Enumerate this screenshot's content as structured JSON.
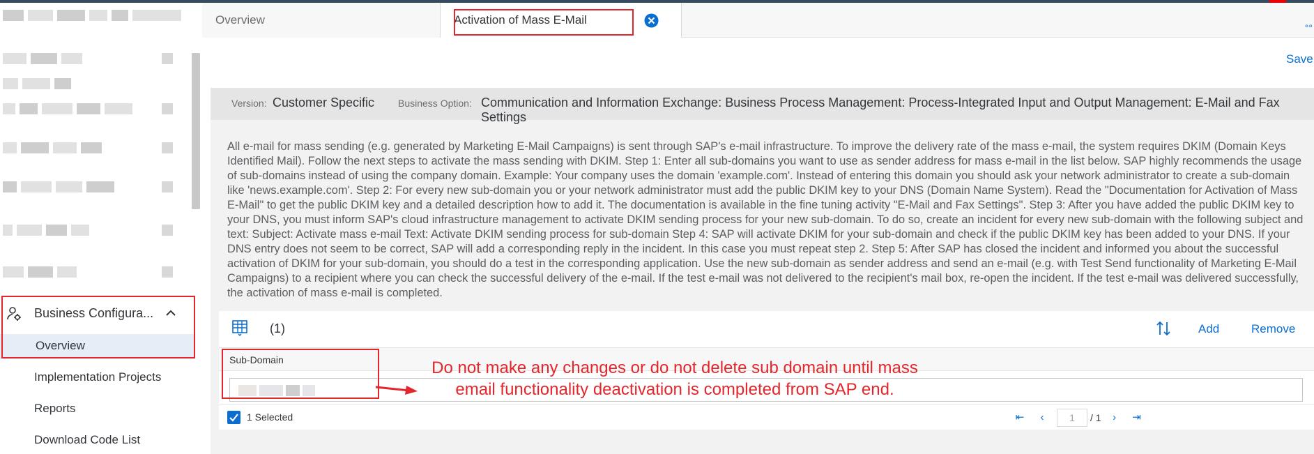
{
  "tabs": {
    "overview": "Overview",
    "active": "Activation of Mass E-Mail"
  },
  "toolbar": {
    "save": "Save",
    "more": "°°"
  },
  "header": {
    "version_label": "Version:",
    "version_value": "Customer Specific",
    "option_label": "Business Option:",
    "option_value": "Communication and Information Exchange: Business Process Management: Process-Integrated Input and Output Management: E-Mail and Fax Settings"
  },
  "description": "All e-mail for mass sending (e.g. generated by Marketing E-Mail Campaigns) is sent through SAP's e-mail infrastructure. To improve the delivery rate of the mass e-mail, the system requires DKIM (Domain Keys Identified Mail). Follow the next steps to activate the mass sending with DKIM. Step 1: Enter all sub-domains you want to use as sender address for mass e-mail in the list below. SAP highly recommends the usage of sub-domains instead of using the company domain. Example: Your company uses the domain 'example.com'. Instead of entering this domain you should ask your network administrator to create a sub-domain like 'news.example.com'. Step 2: For every new sub-domain you or your network administrator must add the public DKIM key to your DNS (Domain Name System). Read the \"Documentation for Activation of Mass E-Mail\" to get the public DKIM key and a detailed description how to add it. The documentation is available in the fine tuning activity \"E-Mail and Fax Settings\". Step 3: After you have added the public DKIM key to your DNS, you must inform SAP's cloud infrastructure management to activate DKIM sending process for your new sub-domain. To do so, create an incident for every new sub-domain with the following subject and text: Subject: Activate mass e-mail Text: Activate DKIM sending process for sub-domain Step 4: SAP will activate DKIM for your sub-domain and check if the public DKIM key has been added to your DNS. If your DNS entry does not seem to be correct, SAP will add a corresponding reply in the incident. In this case you must repeat step 2. Step 5: After SAP has closed the incident and informed you about the successful activation of DKIM for your sub-domain, you should do a test in the corresponding application. Use the new sub-domain as sender address and send an e-mail (e.g. with Test Send functionality of Marketing E-Mail Campaigns) to a recipient where you can check the successful delivery of the e-mail. If the test e-mail was not delivered to the recipient's mail box, re-open the incident. If the test e-mail was delivered successfully, the activation of mass e-mail is completed.",
  "table": {
    "count": "(1)",
    "add": "Add",
    "remove": "Remove",
    "column": "Sub-Domain",
    "selected": "1 Selected",
    "page_current": "1",
    "page_total": "/ 1"
  },
  "sidebar": {
    "group_label": "Business Configura...",
    "items": [
      "Overview",
      "Implementation Projects",
      "Reports",
      "Download Code List"
    ]
  },
  "annotation": "Do not make any changes or do not delete sub domain until mass email functionality deactivation is completed from SAP end.",
  "colors": {
    "accent": "#0a6ed1",
    "annotation": "#e3262b",
    "shell": "#354a5f"
  }
}
